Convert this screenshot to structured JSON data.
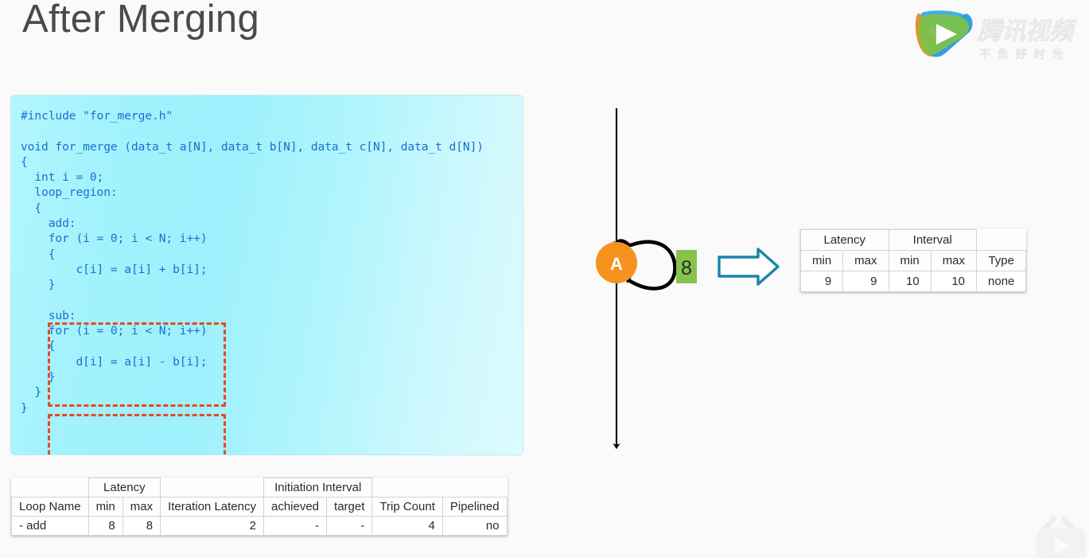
{
  "slide": {
    "title": "After Merging",
    "background_color": "#fafafa",
    "title_color": "#4a4a4a"
  },
  "code_panel": {
    "background_color": "#a3f2fd",
    "text_color": "#1b6fd0",
    "code": "#include \"for_merge.h\"\n\nvoid for_merge (data_t a[N], data_t b[N], data_t c[N], data_t d[N])\n{\n  int i = 0;\n  loop_region:\n  {\n    add:\n    for (i = 0; i < N; i++)\n    {\n        c[i] = a[i] + b[i];\n    }\n\n    sub:\n    for (i = 0; i < N; i++)\n    {\n        d[i] = a[i] - b[i];\n    }\n  }\n}",
    "highlight_boxes": [
      {
        "name": "add-loop",
        "color": "#e8491d"
      },
      {
        "name": "sub-loop",
        "color": "#e8491d"
      }
    ]
  },
  "loop_table": {
    "group_headers": [
      "",
      "Latency",
      "",
      "Initiation Interval",
      "",
      ""
    ],
    "columns": [
      "Loop Name",
      "min",
      "max",
      "Iteration Latency",
      "achieved",
      "target",
      "Trip Count",
      "Pipelined"
    ],
    "rows": [
      [
        "- add",
        "8",
        "8",
        "2",
        "-",
        "-",
        "4",
        "no"
      ]
    ]
  },
  "summary_table": {
    "group_headers": [
      "Latency",
      "Interval",
      ""
    ],
    "columns": [
      "min",
      "max",
      "min",
      "max",
      "Type"
    ],
    "rows": [
      [
        "9",
        "9",
        "10",
        "10",
        "none"
      ]
    ]
  },
  "diagram": {
    "node_label": "A",
    "node_color": "#f5921e",
    "node_text_color": "#ffffff",
    "edge_weight_label": "8",
    "edge_weight_color": "#86c24e",
    "edge_weight_text_color": "#2b2b2b",
    "transition_arrow_color": "#1b84a8",
    "flow_arrow_color": "#000000"
  },
  "watermarks": {
    "brand_name": "腾讯视频",
    "brand_tagline": "不 负 好 时 光"
  }
}
